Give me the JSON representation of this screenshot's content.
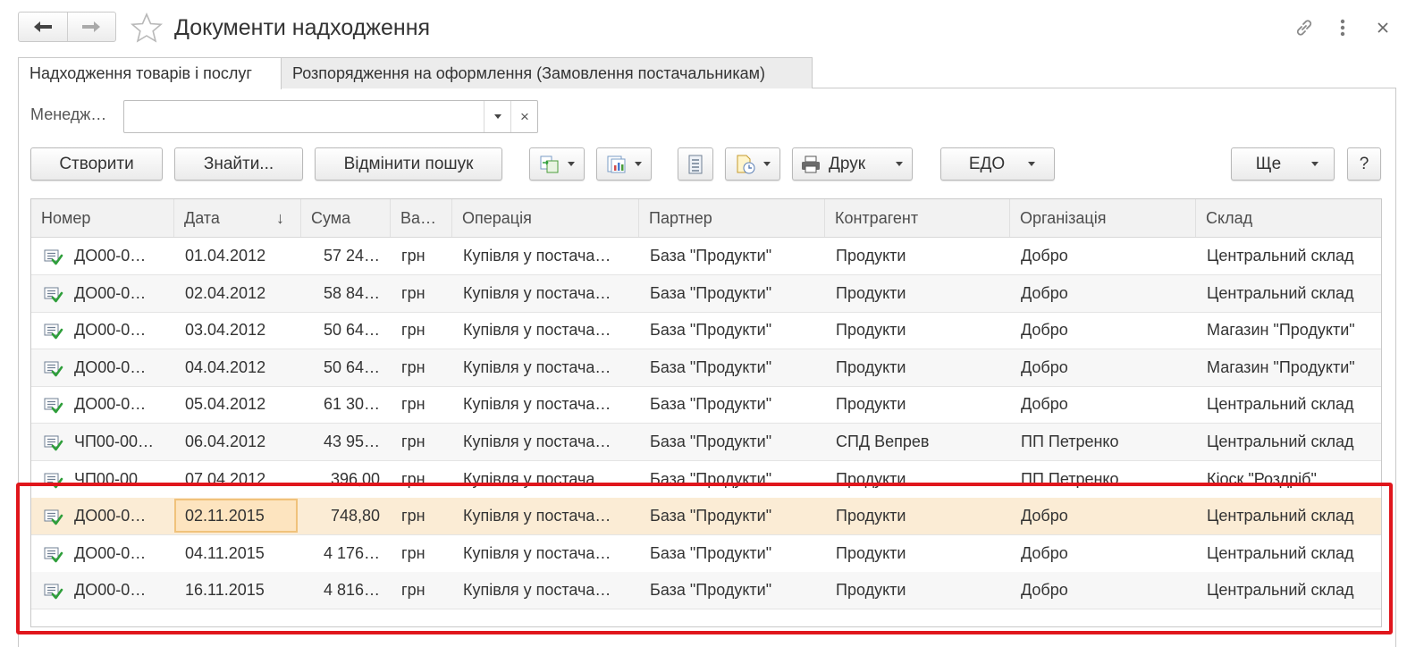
{
  "window": {
    "title": "Документи надходження"
  },
  "tabs": [
    {
      "label": "Надходження товарів і послуг",
      "active": true
    },
    {
      "label": "Розпорядження на оформлення (Замовлення постачальникам)",
      "active": false
    }
  ],
  "filter": {
    "label": "Менедж…",
    "value": ""
  },
  "toolbar": {
    "create": "Створити",
    "find": "Знайти...",
    "cancel_search": "Відмінити пошук",
    "print": "Друк",
    "edo": "ЕДО",
    "more": "Ще",
    "help": "?"
  },
  "table": {
    "columns": [
      "Номер",
      "Дата",
      "Сума",
      "Ва…",
      "Операція",
      "Партнер",
      "Контрагент",
      "Організація",
      "Склад"
    ],
    "sort_indicator": "↓",
    "rows": [
      {
        "number": "ДО00-0…",
        "date": "01.04.2012",
        "sum": "57 24…",
        "currency": "грн",
        "operation": "Купівля у постача…",
        "partner": "База \"Продукти\"",
        "counterparty": "Продукти",
        "organization": "Добро",
        "warehouse": "Центральний склад"
      },
      {
        "number": "ДО00-0…",
        "date": "02.04.2012",
        "sum": "58 84…",
        "currency": "грн",
        "operation": "Купівля у постача…",
        "partner": "База \"Продукти\"",
        "counterparty": "Продукти",
        "organization": "Добро",
        "warehouse": "Центральний склад"
      },
      {
        "number": "ДО00-0…",
        "date": "03.04.2012",
        "sum": "50 64…",
        "currency": "грн",
        "operation": "Купівля у постача…",
        "partner": "База \"Продукти\"",
        "counterparty": "Продукти",
        "organization": "Добро",
        "warehouse": "Магазин \"Продукти\""
      },
      {
        "number": "ДО00-0…",
        "date": "04.04.2012",
        "sum": "50 64…",
        "currency": "грн",
        "operation": "Купівля у постача…",
        "partner": "База \"Продукти\"",
        "counterparty": "Продукти",
        "organization": "Добро",
        "warehouse": "Магазин \"Продукти\""
      },
      {
        "number": "ДО00-0…",
        "date": "05.04.2012",
        "sum": "61 30…",
        "currency": "грн",
        "operation": "Купівля у постача…",
        "partner": "База \"Продукти\"",
        "counterparty": "Продукти",
        "organization": "Добро",
        "warehouse": "Центральний склад"
      },
      {
        "number": "ЧП00-00…",
        "date": "06.04.2012",
        "sum": "43 95…",
        "currency": "грн",
        "operation": "Купівля у постача…",
        "partner": "База \"Продукти\"",
        "counterparty": "СПД Вепрев",
        "organization": "ПП Петренко",
        "warehouse": "Центральний склад"
      },
      {
        "number": "ЧП00-00…",
        "date": "07.04.2012",
        "sum": "396,00",
        "currency": "грн",
        "operation": "Купівля у постача…",
        "partner": "База \"Продукти\"",
        "counterparty": "Продукти",
        "organization": "ПП Петренко",
        "warehouse": "Кіоск \"Роздріб\""
      },
      {
        "number": "ДО00-0…",
        "date": "02.11.2015",
        "sum": "748,80",
        "currency": "грн",
        "operation": "Купівля у постача…",
        "partner": "База \"Продукти\"",
        "counterparty": "Продукти",
        "organization": "Добро",
        "warehouse": "Центральний склад"
      },
      {
        "number": "ДО00-0…",
        "date": "04.11.2015",
        "sum": "4 176…",
        "currency": "грн",
        "operation": "Купівля у постача…",
        "partner": "База \"Продукти\"",
        "counterparty": "Продукти",
        "organization": "Добро",
        "warehouse": "Центральний склад"
      },
      {
        "number": "ДО00-0…",
        "date": "16.11.2015",
        "sum": "4 816…",
        "currency": "грн",
        "operation": "Купівля у постача…",
        "partner": "База \"Продукти\"",
        "counterparty": "Продукти",
        "organization": "Добро",
        "warehouse": "Центральний склад"
      }
    ],
    "selected_row": 7
  },
  "colors": {
    "selection": "#fbecd5",
    "focus_cell": "#fde4bf",
    "highlight_frame": "#e0161c",
    "row_icon_check": "#2e9e3a"
  }
}
